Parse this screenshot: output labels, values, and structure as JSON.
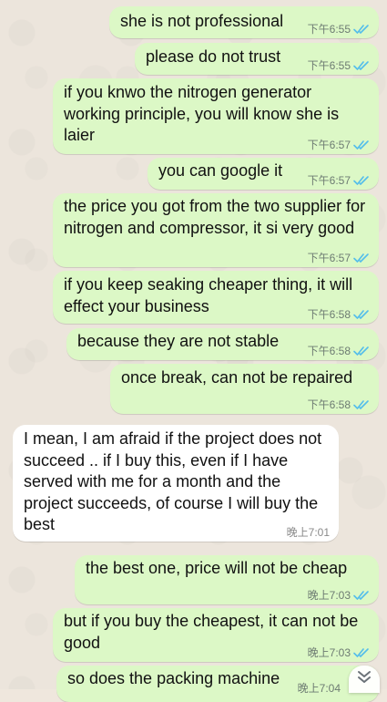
{
  "messages": [
    {
      "dir": "out",
      "text": "she is not professional",
      "time": "下午6:55",
      "read": true
    },
    {
      "dir": "out",
      "text": "please do not trust",
      "time": "下午6:55",
      "read": true
    },
    {
      "dir": "out",
      "text": "if you knwo the nitrogen generator working principle, you will know she is laier",
      "time": "下午6:57",
      "read": true
    },
    {
      "dir": "out",
      "text": "you can google it",
      "time": "下午6:57",
      "read": true
    },
    {
      "dir": "out",
      "text": "the price you got from the two supplier for nitrogen and compressor, it si very good",
      "time": "下午6:57",
      "read": true
    },
    {
      "dir": "out",
      "text": "if you keep seaking cheaper thing, it will effect your business",
      "time": "下午6:58",
      "read": true
    },
    {
      "dir": "out",
      "text": "because they are not stable",
      "time": "下午6:58",
      "read": true
    },
    {
      "dir": "out",
      "text": "once break, can not be repaired",
      "time": "下午6:58",
      "read": true
    },
    {
      "dir": "in",
      "text": "I mean, I am afraid if the project does not succeed .. if I buy this, even if I have served with me for a month and the project succeeds, of course I will buy the best",
      "time": "晚上7:01",
      "read": false
    },
    {
      "dir": "out",
      "text": "the best one, price will not be cheap",
      "time": "晚上7:03",
      "read": true
    },
    {
      "dir": "out",
      "text": "but if you buy the cheapest, it can not be good",
      "time": "晚上7:03",
      "read": true
    },
    {
      "dir": "out",
      "text": "so does the packing machine",
      "time": "晚上7:04",
      "read": true
    }
  ],
  "colors": {
    "outgoing_bubble": "#dcf8c6",
    "incoming_bubble": "#ffffff",
    "read_check": "#53bdeb"
  },
  "scroll_button_icon": "double-chevron-down-icon"
}
